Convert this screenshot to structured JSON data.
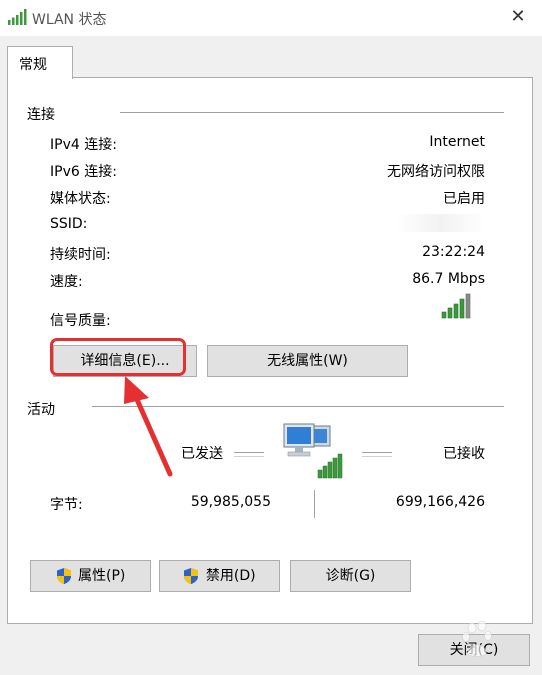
{
  "window": {
    "title": "WLAN 状态",
    "close_glyph": "✕"
  },
  "tabs": [
    {
      "label": "常规"
    }
  ],
  "connection": {
    "title": "连接",
    "rows": [
      {
        "label": "IPv4 连接:",
        "value": "Internet"
      },
      {
        "label": "IPv6 连接:",
        "value": "无网络访问权限"
      },
      {
        "label": "媒体状态:",
        "value": "已启用"
      },
      {
        "label": "SSID:",
        "value": ""
      },
      {
        "label": "持续时间:",
        "value": "23:22:24"
      },
      {
        "label": "速度:",
        "value": "86.7 Mbps"
      }
    ],
    "signal_label": "信号质量:",
    "signal_bars": 5,
    "details_button": "详细信息(E)...",
    "wireless_button": "无线属性(W)"
  },
  "activity": {
    "title": "活动",
    "sent_label": "已发送",
    "received_label": "已接收",
    "bytes_label": "字节:",
    "bytes_sent": "59,985,055",
    "bytes_received": "699,166,426"
  },
  "buttons": {
    "properties": "属性(P)",
    "disable": "禁用(D)",
    "diagnose": "诊断(G)",
    "close": "关闭(C)"
  },
  "icons": {
    "title": "wifi-signal-icon",
    "signal": "signal-strength-icon",
    "network": "network-computers-icon",
    "shield": "uac-shield-icon"
  },
  "colors": {
    "signal_green": "#3c9a3c",
    "highlight_red": "#e43030",
    "shield_blue": "#2a63c9",
    "shield_yellow": "#f6c20e"
  }
}
